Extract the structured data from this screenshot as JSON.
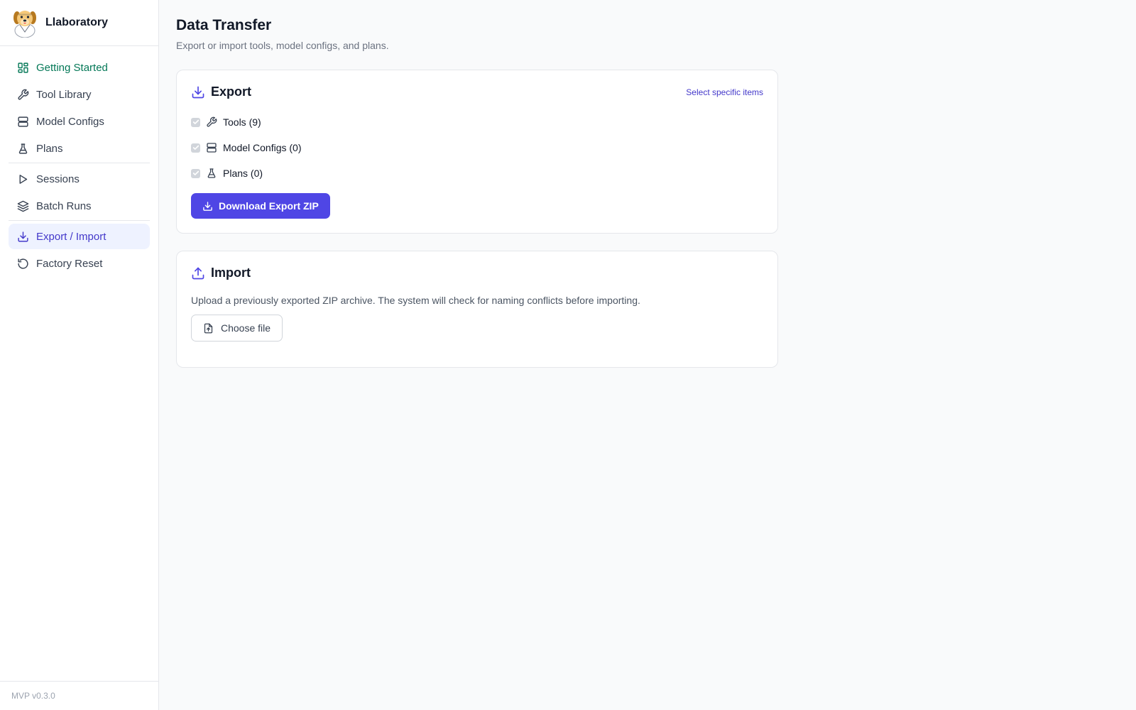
{
  "brand": {
    "name": "Llaboratory",
    "logo_icon": "dog-lab-mascot-icon"
  },
  "sidebar": {
    "items": [
      {
        "label": "Getting Started",
        "icon": "dashboard-icon"
      },
      {
        "label": "Tool Library",
        "icon": "wrench-icon"
      },
      {
        "label": "Model Configs",
        "icon": "server-icon"
      },
      {
        "label": "Plans",
        "icon": "flask-icon"
      },
      {
        "label": "Sessions",
        "icon": "play-icon"
      },
      {
        "label": "Batch Runs",
        "icon": "layers-icon"
      },
      {
        "label": "Export / Import",
        "icon": "download-icon",
        "active": true
      },
      {
        "label": "Factory Reset",
        "icon": "reset-icon"
      }
    ],
    "version": "MVP v0.3.0"
  },
  "page": {
    "title": "Data Transfer",
    "subtitle": "Export or import tools, model configs, and plans."
  },
  "export": {
    "title": "Export",
    "select_link": "Select specific items",
    "items": [
      {
        "label": "Tools (9)",
        "checked": true,
        "icon": "wrench-icon"
      },
      {
        "label": "Model Configs (0)",
        "checked": true,
        "icon": "server-icon"
      },
      {
        "label": "Plans (0)",
        "checked": true,
        "icon": "flask-icon"
      }
    ],
    "download_label": "Download Export ZIP"
  },
  "import": {
    "title": "Import",
    "description": "Upload a previously exported ZIP archive. The system will check for naming conflicts before importing.",
    "choose_label": "Choose file"
  },
  "colors": {
    "accent": "#4f46e5",
    "active_bg": "#eef2ff",
    "getting_started": "#047857"
  }
}
